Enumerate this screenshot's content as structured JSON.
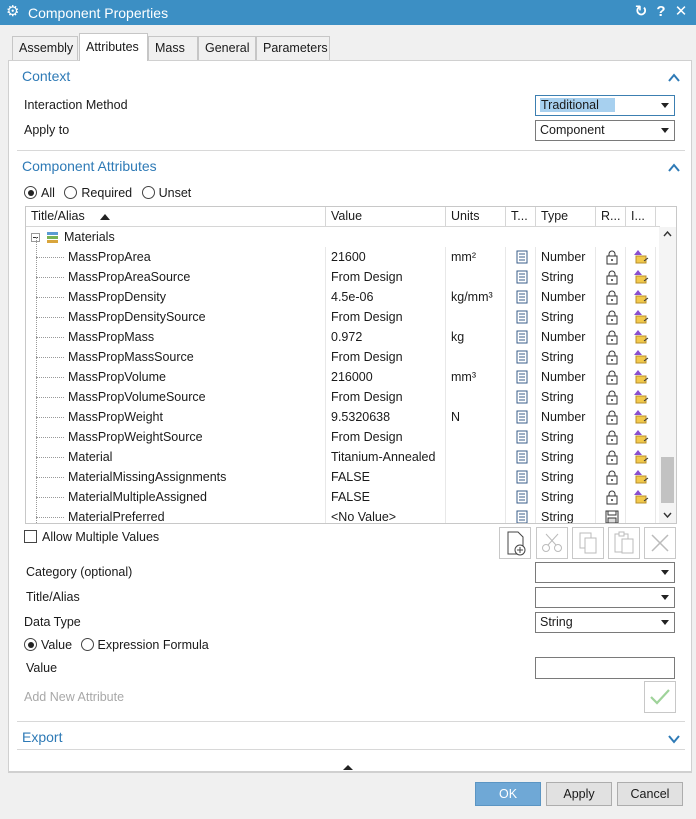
{
  "window": {
    "title": "Component Properties"
  },
  "tabs": [
    "Assembly",
    "Attributes",
    "Mass",
    "General",
    "Parameters"
  ],
  "context": {
    "title": "Context",
    "interaction_label": "Interaction Method",
    "interaction_value": "Traditional",
    "apply_label": "Apply to",
    "apply_value": "Component"
  },
  "attributes": {
    "title": "Component Attributes",
    "filter": {
      "all": "All",
      "required": "Required",
      "unset": "Unset"
    },
    "columns": [
      "Title/Alias",
      "Value",
      "Units",
      "T...",
      "Type",
      "R...",
      "I..."
    ],
    "group": "Materials",
    "rows": [
      {
        "title": "MassPropArea",
        "value": "21600",
        "units": "mm²",
        "type": "Number"
      },
      {
        "title": "MassPropAreaSource",
        "value": "From Design",
        "units": "",
        "type": "String"
      },
      {
        "title": "MassPropDensity",
        "value": "4.5e-06",
        "units": "kg/mm³",
        "type": "Number"
      },
      {
        "title": "MassPropDensitySource",
        "value": "From Design",
        "units": "",
        "type": "String"
      },
      {
        "title": "MassPropMass",
        "value": "0.972",
        "units": "kg",
        "type": "Number"
      },
      {
        "title": "MassPropMassSource",
        "value": "From Design",
        "units": "",
        "type": "String"
      },
      {
        "title": "MassPropVolume",
        "value": "216000",
        "units": "mm³",
        "type": "Number"
      },
      {
        "title": "MassPropVolumeSource",
        "value": "From Design",
        "units": "",
        "type": "String"
      },
      {
        "title": "MassPropWeight",
        "value": "9.5320638",
        "units": "N",
        "type": "Number"
      },
      {
        "title": "MassPropWeightSource",
        "value": "From Design",
        "units": "",
        "type": "String"
      },
      {
        "title": "Material",
        "value": "Titanium-Annealed",
        "units": "",
        "type": "String"
      },
      {
        "title": "MaterialMissingAssignments",
        "value": "FALSE",
        "units": "",
        "type": "String"
      },
      {
        "title": "MaterialMultipleAssigned",
        "value": "FALSE",
        "units": "",
        "type": "String"
      },
      {
        "title": "MaterialPreferred",
        "value": "<No Value>",
        "units": "",
        "type": "String"
      }
    ],
    "allow_multiple": "Allow Multiple Values",
    "category_label": "Category (optional)",
    "title_label": "Title/Alias",
    "datatype_label": "Data Type",
    "datatype_value": "String",
    "value_mode": {
      "value": "Value",
      "expression": "Expression Formula"
    },
    "value_label": "Value",
    "add_new": "Add New Attribute"
  },
  "export": {
    "title": "Export"
  },
  "buttons": {
    "ok": "OK",
    "apply": "Apply",
    "cancel": "Cancel"
  },
  "colors": {
    "titlebar": "#3c8fc4",
    "section": "#2e7ab6",
    "ok": "#6fa8d6"
  }
}
